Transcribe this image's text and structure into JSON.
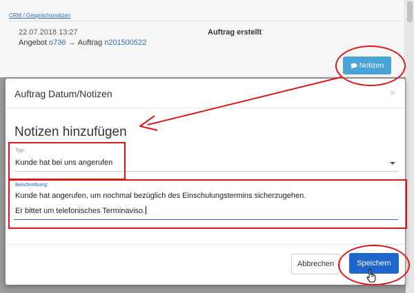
{
  "background": {
    "section_link": "CRM / Gesprächsnotizen",
    "entry": {
      "datetime": "22.07.2018 13:27",
      "status": "Auftrag erstellt",
      "offer_prefix": "Angebot ",
      "offer_number": "o736",
      "arrow": " → ",
      "order_prefix": "Auftrag ",
      "order_number": "n201500522"
    },
    "notes_button": "Notizen"
  },
  "modal": {
    "title": "Auftrag Datum/Notizen",
    "close_glyph": "×",
    "section_title": "Notizen hinzufügen",
    "type_field": {
      "label": "Typ:",
      "value": "Kunde hat bei uns angerufen"
    },
    "description_field": {
      "label": "Beschreibung:",
      "lines": [
        "Kunde hat angerufen, um nochmal bezüglich des Einschulungstermins sicherzugehen.",
        "Er bittet um telefonisches Terminaviso."
      ]
    },
    "cancel_button": "Abbrechen",
    "save_button": "Speichern"
  },
  "colors": {
    "primary": "#1f66cc",
    "info": "#4aa3d6",
    "annotation": "#e01414",
    "link": "#2a6ac0"
  },
  "icons": {
    "notes_button_icon": "comment-icon",
    "type_dropdown_icon": "caret-down-icon",
    "cursor_icon": "hand-pointer-icon"
  }
}
